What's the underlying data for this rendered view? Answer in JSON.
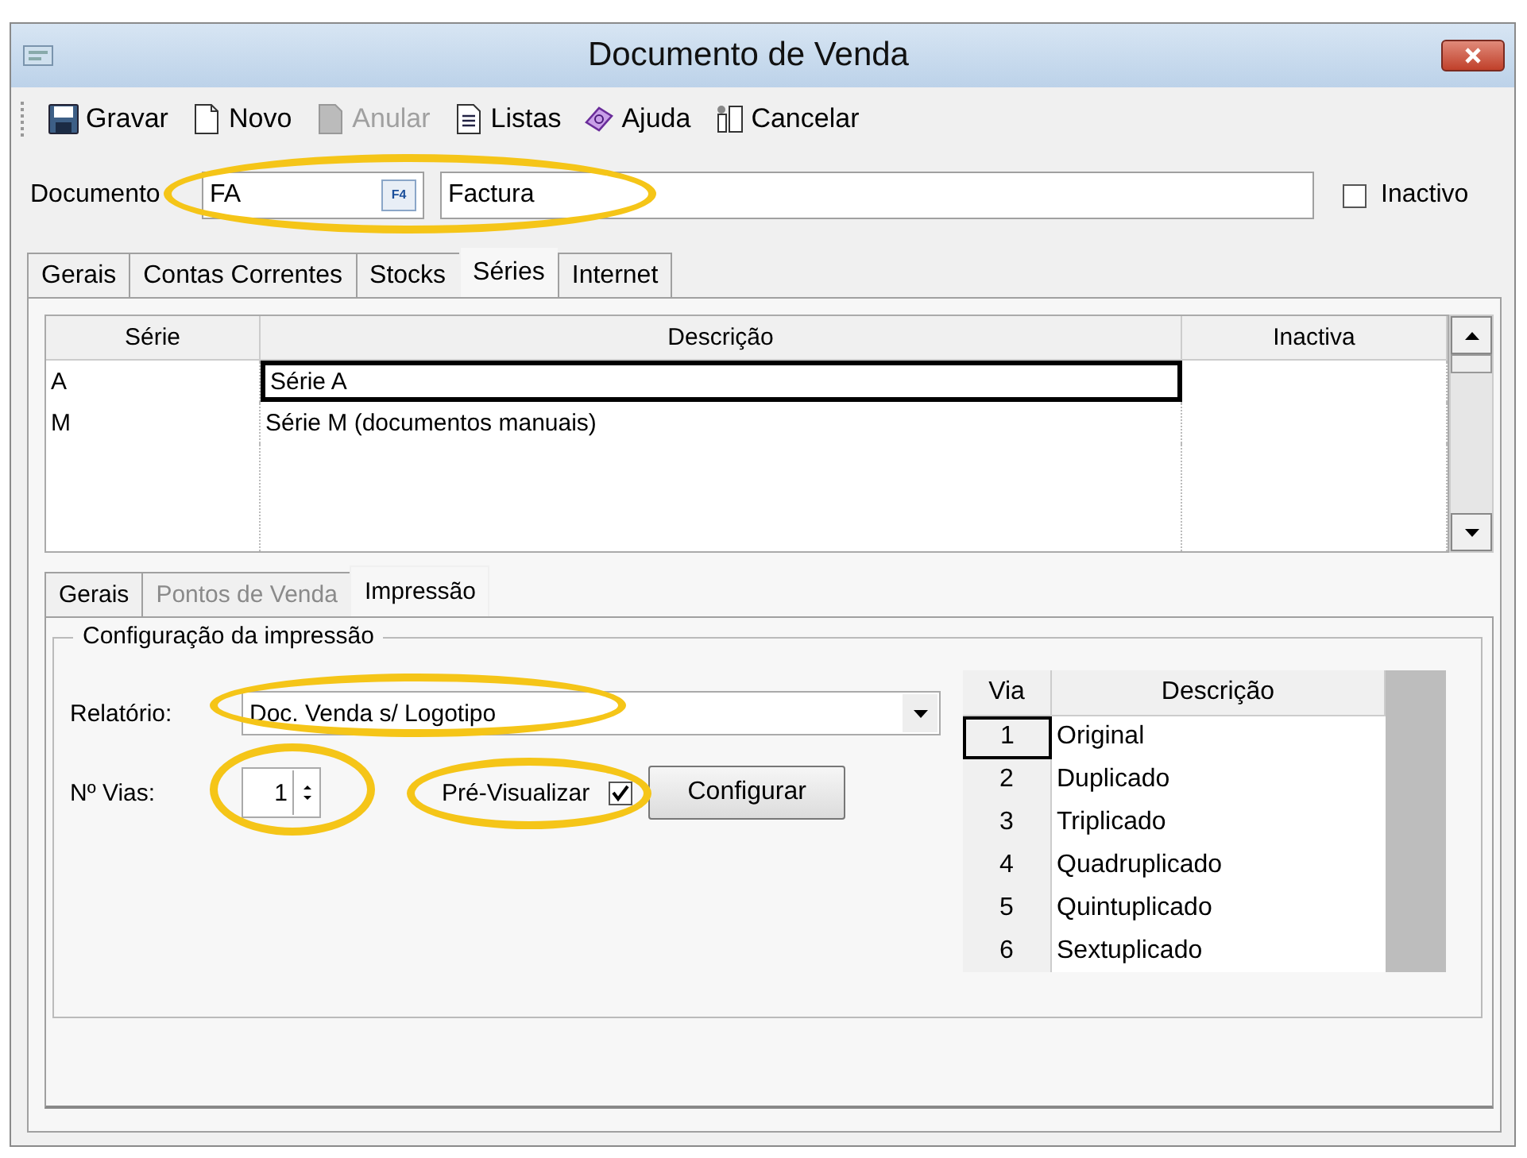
{
  "window": {
    "title": "Documento de Venda"
  },
  "toolbar": [
    {
      "label": "Gravar",
      "disabled": false
    },
    {
      "label": "Novo",
      "disabled": false
    },
    {
      "label": "Anular",
      "disabled": true
    },
    {
      "label": "Listas",
      "disabled": false
    },
    {
      "label": "Ajuda",
      "disabled": false
    },
    {
      "label": "Cancelar",
      "disabled": false
    }
  ],
  "document": {
    "label": "Documento",
    "code": "FA",
    "lookup_key": "F4",
    "name": "Factura",
    "highlighted": true,
    "inactive": {
      "label": "Inactivo",
      "checked": false
    }
  },
  "tabs": [
    {
      "label": "Gerais",
      "selected": false
    },
    {
      "label": "Contas Correntes",
      "selected": false
    },
    {
      "label": "Stocks",
      "selected": false
    },
    {
      "label": "Séries",
      "selected": true
    },
    {
      "label": "Internet",
      "selected": false
    }
  ],
  "series_table": {
    "columns": [
      "Série",
      "Descrição",
      "Inactiva"
    ],
    "rows": [
      {
        "serie": "A",
        "descricao": "Série A",
        "selected": true
      },
      {
        "serie": "M",
        "descricao": "Série M (documentos manuais)",
        "selected": false
      }
    ]
  },
  "subtabs": [
    {
      "label": "Gerais",
      "selected": false,
      "disabled": false
    },
    {
      "label": "Pontos de Venda",
      "selected": false,
      "disabled": true
    },
    {
      "label": "Impressão",
      "selected": true,
      "disabled": false
    }
  ],
  "print_config": {
    "title": "Configuração da impressão",
    "report": {
      "label": "Relatório:",
      "value": "Doc. Venda s/ Logotipo",
      "highlighted": true
    },
    "copies": {
      "label": "Nº Vias:",
      "value": "1",
      "highlighted": true
    },
    "preview": {
      "label": "Pré-Visualizar",
      "checked": true,
      "highlighted": true
    },
    "configure_button": "Configurar",
    "copies_table": {
      "columns": [
        "Via",
        "Descrição"
      ],
      "rows": [
        {
          "via": "1",
          "descricao": "Original",
          "selected": true
        },
        {
          "via": "2",
          "descricao": "Duplicado",
          "selected": false
        },
        {
          "via": "3",
          "descricao": "Triplicado",
          "selected": false
        },
        {
          "via": "4",
          "descricao": "Quadruplicado",
          "selected": false
        },
        {
          "via": "5",
          "descricao": "Quintuplicado",
          "selected": false
        },
        {
          "via": "6",
          "descricao": "Sextuplicado",
          "selected": false
        }
      ]
    }
  }
}
